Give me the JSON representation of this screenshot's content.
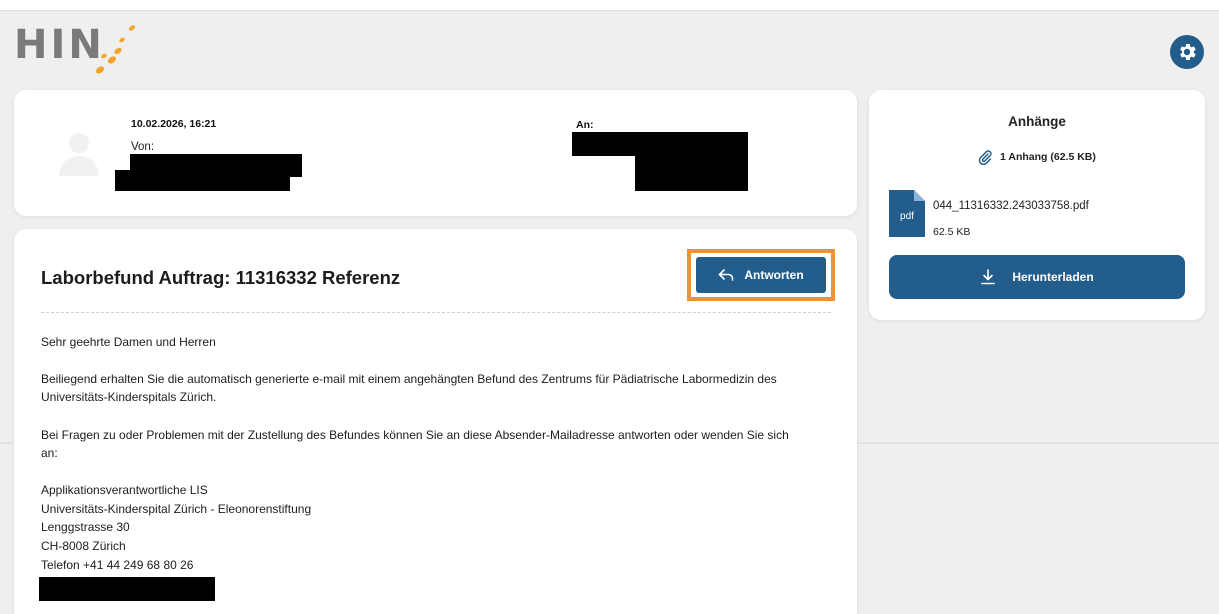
{
  "logo": {
    "text": "HIN"
  },
  "header": {
    "datetime": "10.02.2026, 16:21",
    "from_label": "Von:",
    "to_label": "An:"
  },
  "attachments": {
    "title": "Anhänge",
    "count_text": "1 Anhang (62.5 KB)",
    "file": {
      "type_label": "pdf",
      "name": "044_11316332.243033758.pdf",
      "size": "62.5 KB"
    },
    "download_label": "Herunterladen"
  },
  "message": {
    "subject": "Laborbefund Auftrag: 11316332 Referenz",
    "reply_label": "Antworten",
    "greeting": "Sehr geehrte Damen und Herren",
    "para1_line1": "Beiliegend erhalten Sie die automatisch generierte e-mail mit einem angehängten Befund des Zentrums für Pädiatrische Labormedizin des",
    "para1_line2": "Universitäts-Kinderspitals Zürich.",
    "para2_line1": "Bei Fragen zu oder Problemen mit der Zustellung des Befundes können Sie an diese Absender-Mailadresse antworten oder wenden Sie sich",
    "para2_line2": "an:",
    "contact": [
      "Applikationsverantwortliche LIS",
      "Universitäts-Kinderspital Zürich - Eleonorenstiftung",
      "Lenggstrasse 30",
      "CH-8008 Zürich",
      "Telefon +41 44 249 68 80 26"
    ]
  },
  "colors": {
    "primary": "#235d8c",
    "highlight": "#f0922e",
    "logo_accent": "#f2a52b",
    "logo_grey": "#7a7a7a"
  },
  "icons": [
    "gear-icon",
    "avatar-icon",
    "paperclip-icon",
    "pdf-file-icon",
    "download-icon",
    "reply-arrow-icon"
  ]
}
